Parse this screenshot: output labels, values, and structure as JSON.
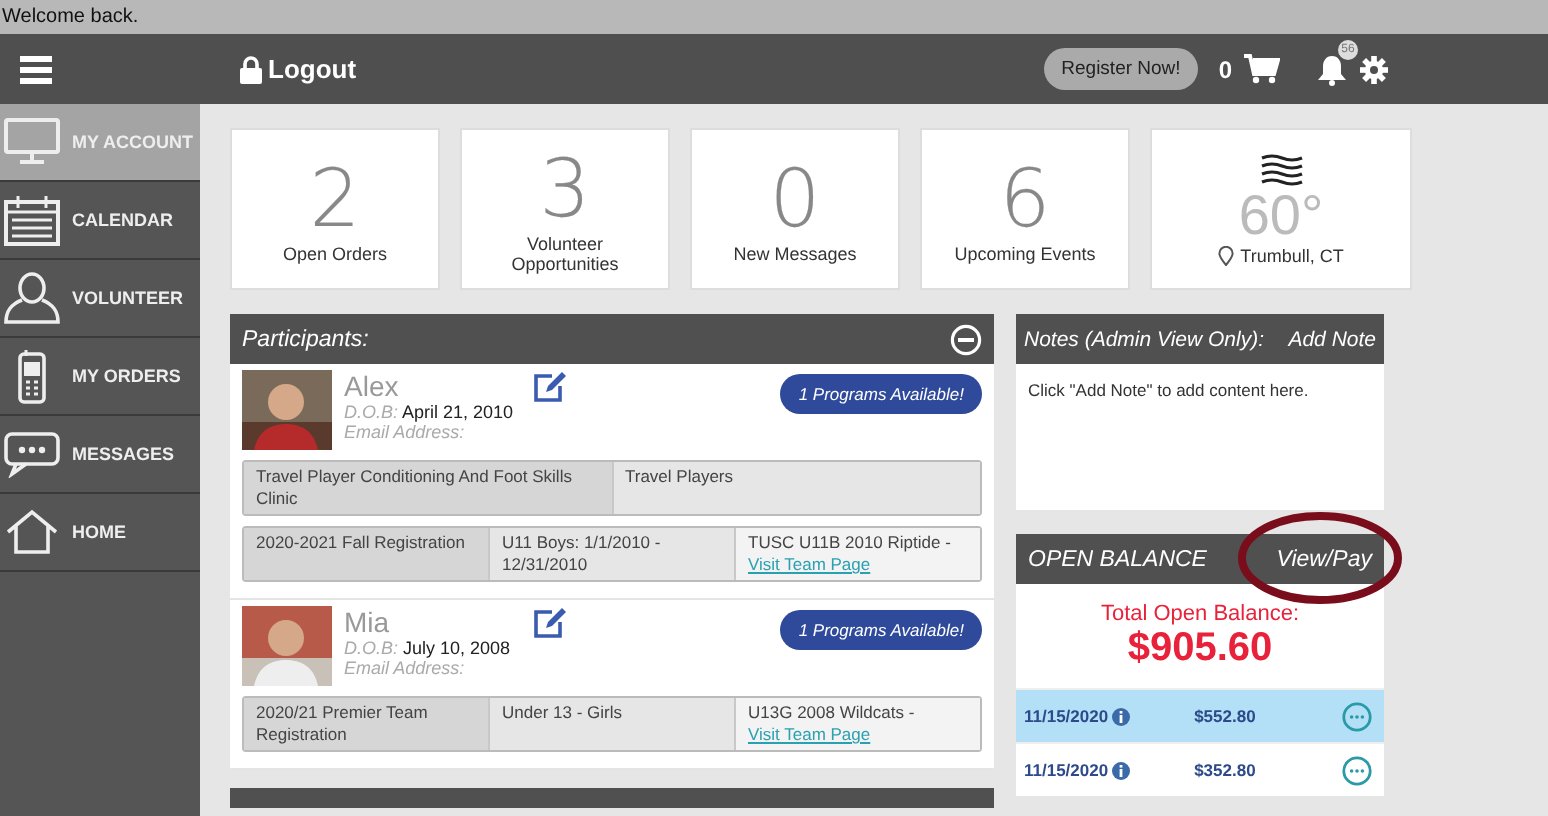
{
  "welcome": "Welcome back.",
  "header": {
    "logout": "Logout",
    "register": "Register Now!",
    "cart_count": "0",
    "notification_count": "56"
  },
  "sidebar": {
    "items": [
      {
        "label": "MY ACCOUNT",
        "selected": true
      },
      {
        "label": "CALENDAR",
        "selected": false
      },
      {
        "label": "VOLUNTEER",
        "selected": false
      },
      {
        "label": "MY ORDERS",
        "selected": false
      },
      {
        "label": "MESSAGES",
        "selected": false
      },
      {
        "label": "HOME",
        "selected": false
      }
    ]
  },
  "stats": [
    {
      "value": "2",
      "label": "Open Orders"
    },
    {
      "value": "3",
      "label": "Volunteer Opportunities"
    },
    {
      "value": "0",
      "label": "New Messages"
    },
    {
      "value": "6",
      "label": "Upcoming Events"
    }
  ],
  "weather": {
    "temperature": "60°",
    "location": "Trumbull, CT"
  },
  "participants": {
    "title": "Participants:",
    "people": [
      {
        "name": "Alex",
        "dob_label": "D.O.B:",
        "dob": "April 21, 2010",
        "email_label": "Email Address:",
        "programs_button": "1 Programs Available!",
        "tracks": [
          [
            {
              "text": "Travel Player Conditioning And Foot Skills Clinic"
            },
            {
              "text": "Travel Players"
            }
          ],
          [
            {
              "text": "2020-2021 Fall Registration"
            },
            {
              "text": "U11 Boys: 1/1/2010 - 12/31/2010"
            },
            {
              "text": "TUSC U11B 2010 Riptide - ",
              "link": "Visit Team Page"
            }
          ]
        ]
      },
      {
        "name": "Mia",
        "dob_label": "D.O.B:",
        "dob": "July 10, 2008",
        "email_label": "Email Address:",
        "programs_button": "1 Programs Available!",
        "tracks": [
          [
            {
              "text": "2020/21 Premier Team Registration"
            },
            {
              "text": "Under 13 - Girls"
            },
            {
              "text": "U13G 2008 Wildcats - ",
              "link": "Visit Team Page"
            }
          ]
        ]
      }
    ]
  },
  "notes": {
    "title": "Notes (Admin View Only):",
    "action": "Add Note",
    "body": "Click \"Add Note\" to add content here."
  },
  "balance": {
    "title": "OPEN BALANCE",
    "action": "View/Pay",
    "total_label": "Total Open Balance:",
    "total": "$905.60",
    "rows": [
      {
        "date": "11/15/2020",
        "amount": "$552.80",
        "selected": true
      },
      {
        "date": "11/15/2020",
        "amount": "$352.80",
        "selected": false
      }
    ]
  }
}
